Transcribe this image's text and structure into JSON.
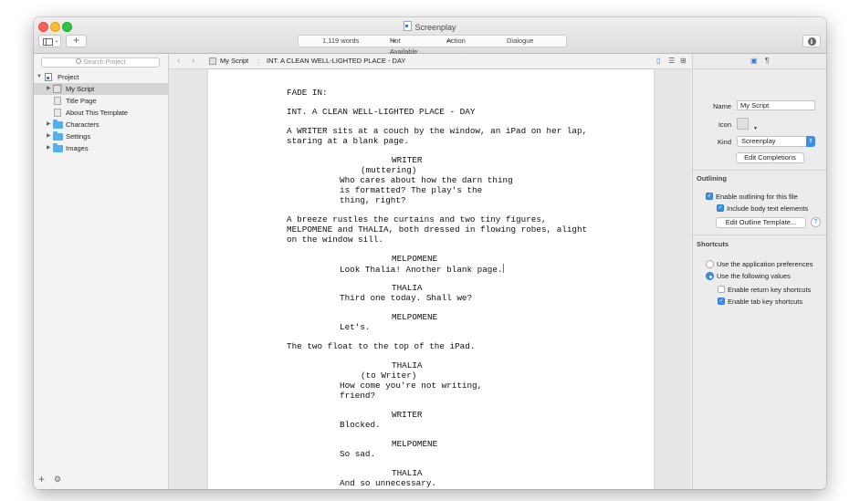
{
  "window": {
    "title": "Screenplay"
  },
  "toolbar": {
    "word_count": "1,119 words",
    "tab_key_action": "Not Available",
    "return_key_action": "Action",
    "element_type": "Dialogue",
    "tab_symbol": "⇥",
    "return_symbol": "↩",
    "add_symbol": "+",
    "info_symbol": "i"
  },
  "sidebar": {
    "search_placeholder": "Search Project",
    "items": [
      {
        "label": "Project",
        "icon": "project-icon"
      },
      {
        "label": "My Script",
        "icon": "document-stack-icon",
        "selected": true
      },
      {
        "label": "Title Page",
        "icon": "document-icon"
      },
      {
        "label": "About This Template",
        "icon": "document-icon"
      },
      {
        "label": "Characters",
        "icon": "folder-icon"
      },
      {
        "label": "Settings",
        "icon": "folder-icon"
      },
      {
        "label": "Images",
        "icon": "folder-icon"
      }
    ],
    "footer_add": "+",
    "footer_gear": "⚙"
  },
  "editor": {
    "breadcrumb": {
      "document": "My Script",
      "separator": ":",
      "scene": "INT. A CLEAN WELL-LIGHTED PLACE - DAY"
    },
    "script": [
      "FADE IN:",
      "INT. A CLEAN WELL-LIGHTED PLACE - DAY",
      "A WRITER sits at a couch by the window, an iPad on her lap,",
      "staring at a blank page.",
      "WRITER",
      "(muttering)",
      "Who cares about how the darn thing",
      "is formatted? The play's the",
      "thing, right?",
      "A breeze rustles the curtains and two tiny figures,",
      "MELPOMENE and THALIA, both dressed in flowing robes, alight",
      "on the window sill.",
      "MELPOMENE",
      "Look Thalia! Another blank page.",
      "THALIA",
      "Third one today. Shall we?",
      "MELPOMENE",
      "Let's.",
      "The two float to the top of the iPad.",
      "THALIA",
      "(to Writer)",
      "How come you're not writing,",
      "friend?",
      "WRITER",
      "Blocked.",
      "MELPOMENE",
      "So sad.",
      "THALIA",
      "And so unnecessary."
    ]
  },
  "inspector": {
    "name_label": "Name",
    "name_value": "My Script",
    "icon_label": "Icon",
    "kind_label": "Kind",
    "kind_value": "Screenplay",
    "edit_completions": "Edit Completions",
    "outlining_title": "Outlining",
    "enable_outlining": "Enable outlining for this file",
    "include_body_text": "Include body text elements",
    "edit_outline_template": "Edit Outline Template...",
    "help": "?",
    "shortcuts_title": "Shortcuts",
    "use_app_prefs": "Use the application preferences",
    "use_following": "Use the following values",
    "enable_return_key": "Enable return key shortcuts",
    "enable_tab_key": "Enable tab key shortcuts"
  },
  "colors": {
    "accent": "#3a8ee6",
    "folder": "#5aaee8",
    "selection": "#d5d5d5"
  }
}
